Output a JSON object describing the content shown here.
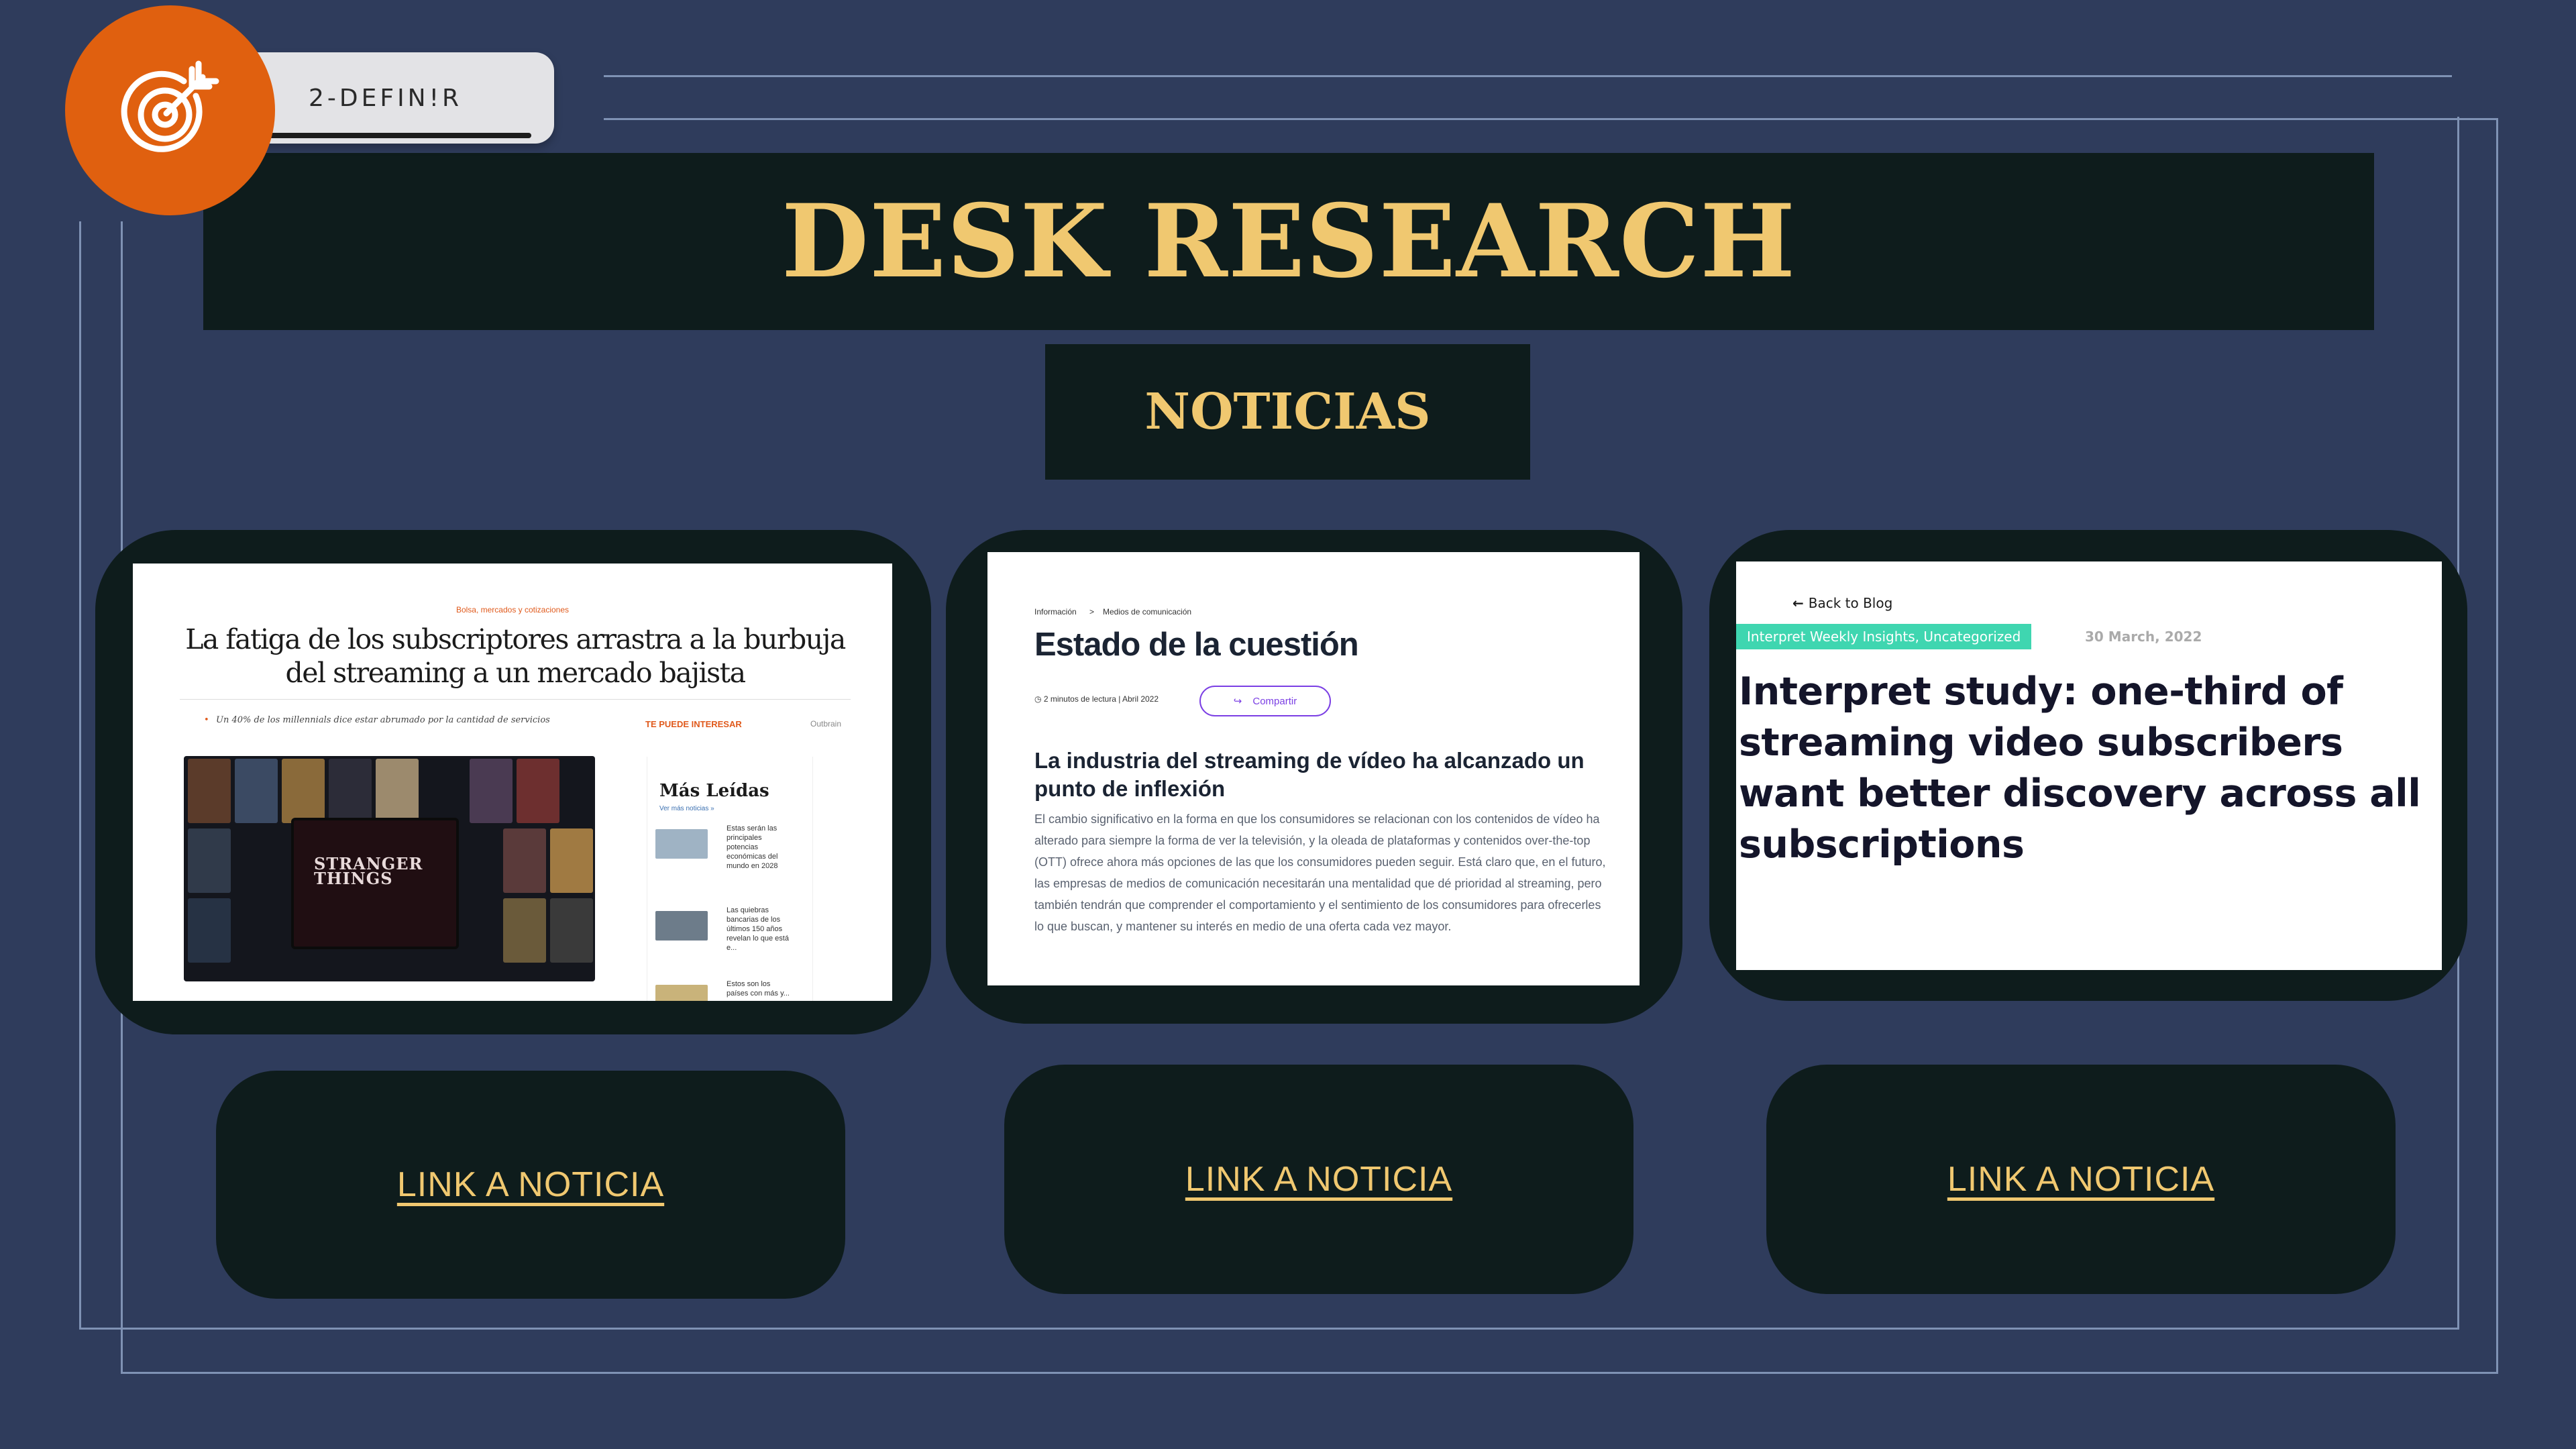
{
  "step_tab": {
    "label": "2-DEFIN!R"
  },
  "header": {
    "title": "DESK RESEARCH",
    "subtitle": "NOTICIAS"
  },
  "articles": [
    {
      "kicker": "Bolsa, mercados y cotizaciones",
      "title": "La fatiga de los subscriptores arrastra a la burbuja del streaming a un mercado bajista",
      "lead": "Un 40% de los millennials dice estar abrumado por la cantidad de servicios",
      "might_interest": "TE PUEDE INTERESAR",
      "outbrain": "Outbrain",
      "image_text": "STRANGER THINGS",
      "sidebar_title": "Más Leídas",
      "sidebar_more": "Ver más noticias »",
      "sidebar_items": [
        "Estas serán las principales potencias económicas del mundo en 2028",
        "Las quiebras bancarias de los últimos 150 años revelan lo que está e...",
        "Estos son los países con más y..."
      ]
    },
    {
      "breadcrumb": [
        "Información",
        ">",
        "Medios de comunicación"
      ],
      "title": "Estado de la cuestión",
      "meta": "2 minutos de lectura | Abril 2022",
      "share_label": "Compartir",
      "heading": "La industria del streaming de vídeo ha alcanzado un punto de inflexión",
      "body": "El cambio significativo en la forma en que los consumidores se relacionan con los contenidos de vídeo ha alterado para siempre la forma de ver la televisión, y la oleada de plataformas y contenidos over-the-top (OTT) ofrece ahora más opciones de las que los consumidores pueden seguir. Está claro que, en el futuro, las empresas de medios de comunicación necesitarán una mentalidad que dé prioridad al streaming, pero también tendrán que comprender el comportamiento y el sentimiento de los consumidores para ofrecerles lo que buscan, y mantener su interés en medio de una oferta cada vez mayor."
    },
    {
      "back_label": "Back to Blog",
      "tags": "Interpret Weekly Insights, Uncategorized",
      "date": "30 March, 2022",
      "title": "Interpret study: one-third of streaming video subscribers want better discovery across all subscriptions"
    }
  ],
  "links": [
    {
      "label": "LINK A NOTICIA"
    },
    {
      "label": "LINK A NOTICIA"
    },
    {
      "label": "LINK A NOTICIA"
    }
  ],
  "colors": {
    "background": "#2f3c5c",
    "panel": "#0e1c1c",
    "gold": "#f0c870",
    "badge": "#e0600f",
    "tag": "#3fd6b0",
    "share": "#7b3fe4"
  },
  "icons": {
    "badge": "target-arrow-icon"
  }
}
